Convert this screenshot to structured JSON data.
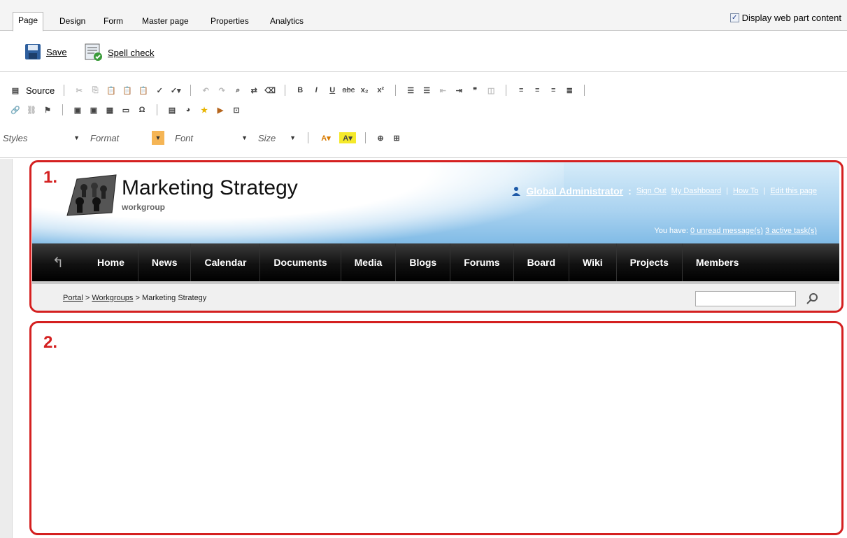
{
  "tabs": {
    "items": [
      {
        "label": "Page",
        "active": true
      },
      {
        "label": "Design"
      },
      {
        "label": "Form"
      },
      {
        "label": "Master page"
      },
      {
        "label": "Properties"
      },
      {
        "label": "Analytics"
      }
    ],
    "display_label": "Display web part content",
    "display_checked": true
  },
  "actions": {
    "save_label": "Save",
    "spell_label": "Spell check"
  },
  "editor": {
    "source_label": "Source",
    "styles": "Styles",
    "format": "Format",
    "font": "Font",
    "size": "Size"
  },
  "site": {
    "title": "Marketing Strategy",
    "subtitle": "workgroup",
    "user_name": "Global Administrator",
    "user_sep": ":",
    "links": [
      "Sign Out",
      "My Dashboard",
      "How To",
      "Edit this page"
    ],
    "msg_prefix": "You have:",
    "msg_unread": "0 unread message(s)",
    "msg_tasks": "3 active task(s)"
  },
  "nav": {
    "items": [
      "Home",
      "News",
      "Calendar",
      "Documents",
      "Media",
      "Blogs",
      "Forums",
      "Board",
      "Wiki",
      "Projects",
      "Members"
    ]
  },
  "breadcrumb": {
    "portal": "Portal",
    "sep": ">",
    "workgroups": "Workgroups",
    "current": "Marketing Strategy"
  },
  "annotations": {
    "zone1": "1.",
    "zone2": "2.",
    "color": "#d42020"
  }
}
